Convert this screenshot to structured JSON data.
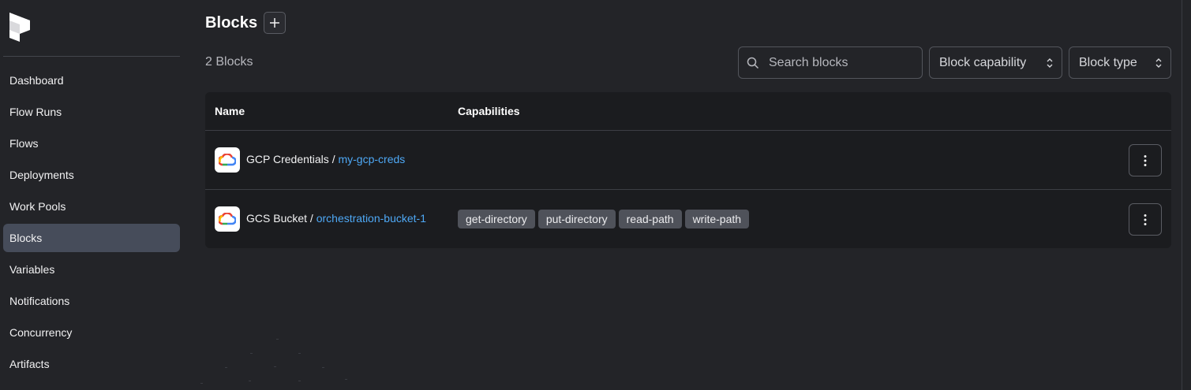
{
  "sidebar": {
    "logo_icon": "prefect-logo-icon",
    "items": [
      {
        "label": "Dashboard",
        "active": false
      },
      {
        "label": "Flow Runs",
        "active": false
      },
      {
        "label": "Flows",
        "active": false
      },
      {
        "label": "Deployments",
        "active": false
      },
      {
        "label": "Work Pools",
        "active": false
      },
      {
        "label": "Blocks",
        "active": true
      },
      {
        "label": "Variables",
        "active": false
      },
      {
        "label": "Notifications",
        "active": false
      },
      {
        "label": "Concurrency",
        "active": false
      },
      {
        "label": "Artifacts",
        "active": false
      }
    ]
  },
  "header": {
    "title": "Blocks",
    "add_icon": "plus-icon"
  },
  "toolbar": {
    "count_label": "2 Blocks",
    "search_placeholder": "Search blocks",
    "capability_select": "Block capability",
    "type_select": "Block type"
  },
  "table": {
    "columns": [
      "Name",
      "Capabilities"
    ],
    "rows": [
      {
        "icon": "google-cloud-icon",
        "type": "GCP Credentials",
        "separator": "/",
        "name": "my-gcp-creds",
        "capabilities": []
      },
      {
        "icon": "google-cloud-icon",
        "type": "GCS Bucket",
        "separator": "/",
        "name": "orchestration-bucket-1",
        "capabilities": [
          "get-directory",
          "put-directory",
          "read-path",
          "write-path"
        ]
      }
    ]
  },
  "colors": {
    "background": "#232428",
    "table_background": "#1b1c1f",
    "active_nav": "#464c5a",
    "link": "#4ea8f5",
    "badge": "#4f525a"
  }
}
